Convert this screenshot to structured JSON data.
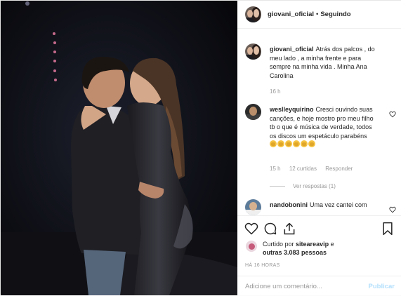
{
  "post": {
    "photo_alt": "",
    "header": {
      "username": "giovani_oficial",
      "separator": "•",
      "follow_status": "Seguindo"
    },
    "caption": {
      "username": "giovani_oficial",
      "text": "Atrás dos palcos , do meu lado , a minha frente e para sempre na minha vida . Minha Ana Carolina",
      "time": "16 h"
    },
    "comments": [
      {
        "username": "weslleyquirino",
        "text": "Cresci ouvindo suas canções, e hoje mostro pro meu filho tb o que é música de verdade, todos os discos um espetáculo parabéns",
        "time": "15 h",
        "likes": "12 curtidas",
        "reply_label": "Responder",
        "view_replies": "Ver respostas (1)"
      },
      {
        "username": "nandobonini",
        "text": "Uma vez cantei com"
      }
    ],
    "likes": {
      "prefix": "Curtido por",
      "user": "siteareavip",
      "joiner": "e",
      "others": "outras 3.083 pessoas"
    },
    "time_ago": "HÁ 16 HORAS",
    "comment_input": {
      "placeholder": "Adicione um comentário...",
      "publish_label": "Publicar"
    },
    "icons": [
      "heart-icon",
      "comment-icon",
      "share-icon",
      "bookmark-icon"
    ]
  }
}
